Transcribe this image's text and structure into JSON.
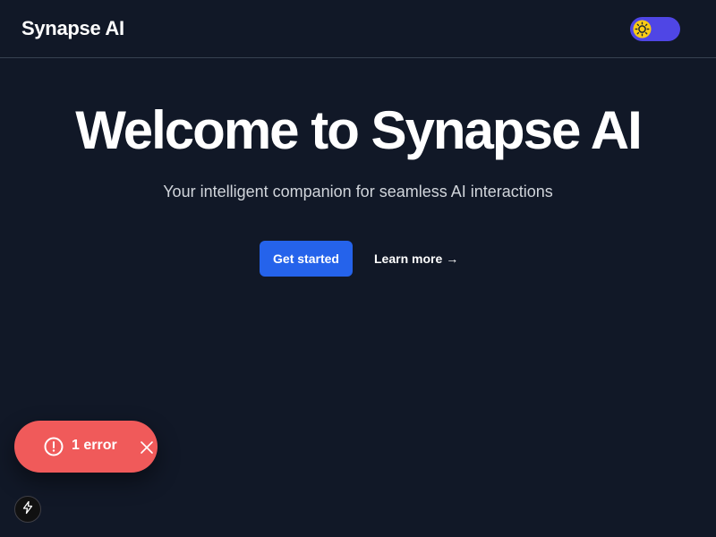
{
  "header": {
    "brand": "Synapse AI",
    "theme_toggle": {
      "icon": "sun-icon",
      "color": "#4f46e5"
    }
  },
  "hero": {
    "title": "Welcome to Synapse AI",
    "subtitle": "Your intelligent companion for seamless AI interactions",
    "primary_button": "Get started",
    "secondary_link": "Learn more",
    "secondary_link_arrow": "→"
  },
  "error_toast": {
    "label": "1 error",
    "icon": "alert-circle-icon",
    "dismiss_icon": "close-icon",
    "color": "#f05a5a"
  },
  "dev_indicator": {
    "icon": "lightning-bolt-icon"
  },
  "colors": {
    "background": "#111827",
    "primary": "#2563eb",
    "subtitle": "#d1d5db",
    "divider": "#374151"
  }
}
